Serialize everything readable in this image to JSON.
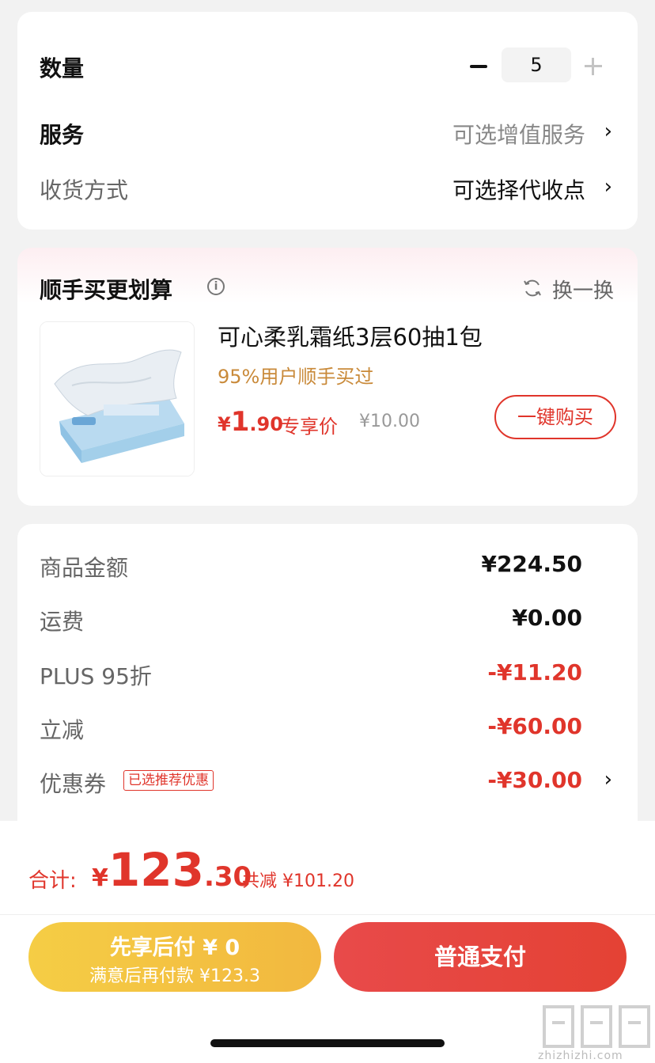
{
  "quantity_section": {
    "qty_label": "数量",
    "qty_value": "5",
    "service_label": "服务",
    "service_value": "可选增值服务",
    "delivery_label": "收货方式",
    "delivery_value": "可选择代收点"
  },
  "addon_section": {
    "title": "顺手买更划算",
    "info_icon": "i",
    "refresh_label": "换一换",
    "product": {
      "name": "可心柔乳霜纸3层60抽1包",
      "social_proof": "95%用户顺手买过",
      "price_currency": "¥",
      "price_int": "1",
      "price_dec": ".90",
      "price_tag": "专享价",
      "original_price": "¥10.00",
      "buy_label": "一键购买"
    }
  },
  "summary": {
    "rows": [
      {
        "label": "商品金额",
        "value": "¥224.50"
      },
      {
        "label": "运费",
        "value": "¥0.00"
      },
      {
        "label": "PLUS 95折",
        "value": "-¥11.20"
      },
      {
        "label": "立减",
        "value": "-¥60.00"
      },
      {
        "label": "优惠券",
        "value": "-¥30.00"
      }
    ],
    "coupon_badge": "已选推荐优惠"
  },
  "bottom": {
    "total_label": "合计:",
    "total_currency": "¥",
    "total_int": "123",
    "total_dec": ".30",
    "total_discount": "共减 ¥101.20",
    "later_line1": "先享后付 ¥ 0",
    "later_line2": "满意后再付款 ¥123.3",
    "pay_label": "普通支付"
  },
  "watermark": {
    "site": "zhizhizhi.com"
  },
  "colors": {
    "accent_red": "#e0352b",
    "gold": "#c98a3a",
    "later_button": "#f2c043",
    "pay_button": "#e64538"
  },
  "icons": {
    "info": "info-icon",
    "refresh": "refresh-icon",
    "minus": "minus-icon",
    "plus": "plus-icon",
    "chevron": "chevron-right-icon"
  }
}
